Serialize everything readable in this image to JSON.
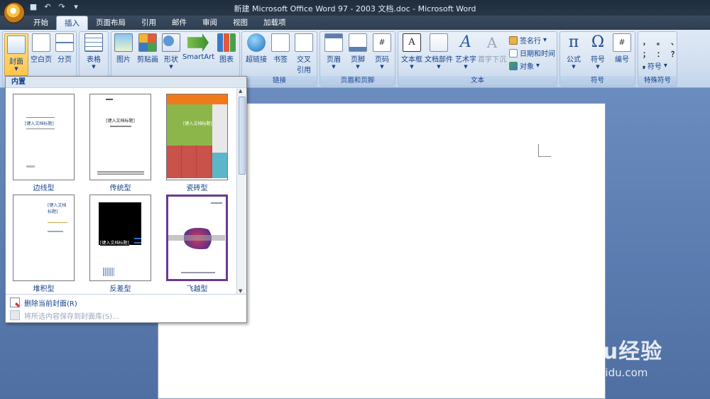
{
  "window": {
    "title": "新建 Microsoft Office Word 97 - 2003 文档.doc - Microsoft Word"
  },
  "tabs": [
    "开始",
    "插入",
    "页面布局",
    "引用",
    "邮件",
    "审阅",
    "视图",
    "加载项"
  ],
  "ribbon": {
    "pages": {
      "cover": "封面",
      "blank": "空白页",
      "break": "分页"
    },
    "tables": {
      "table": "表格"
    },
    "illustrations": {
      "picture": "图片",
      "clipart": "剪贴画",
      "shapes": "形状",
      "smartart": "SmartArt",
      "chart": "图表"
    },
    "links": {
      "hyperlink": "超链接",
      "bookmark": "书签",
      "crossref_1": "交叉",
      "crossref_2": "引用",
      "label": "链接"
    },
    "header_footer": {
      "header": "页眉",
      "footer": "页脚",
      "page_number": "页码",
      "label": "页眉和页脚"
    },
    "text": {
      "textbox": "文本框",
      "quickparts": "文档部件",
      "wordart": "艺术字",
      "dropcap": "首字下沉",
      "signature": "签名行",
      "datetime": "日期和时间",
      "object": "对象",
      "label": "文本"
    },
    "symbols": {
      "equation": "公式",
      "symbol": "符号",
      "number": "编号",
      "label": "符号"
    },
    "special": {
      "symbol": "符号",
      "label": "特殊符号",
      "chars": [
        "，",
        "。",
        "、",
        "；",
        "：",
        "？"
      ]
    }
  },
  "gallery": {
    "header": "内置",
    "items": [
      {
        "label": "边线型",
        "title": "[键入文档标题]"
      },
      {
        "label": "传统型",
        "title": "[键入文档标题]"
      },
      {
        "label": "瓷砖型",
        "title": "[键入文档标题]"
      },
      {
        "label": "堆积型",
        "title": "[键入文档标题]"
      },
      {
        "label": "反差型",
        "title": "[键入文档标题]"
      },
      {
        "label": "飞越型",
        "title": ""
      }
    ],
    "remove": "删除当前封面(R)",
    "save": "将所选内容保存到封面库(S)..."
  },
  "watermark": {
    "brand": "Baidu经验",
    "url": "jingyan.baidu.com"
  }
}
